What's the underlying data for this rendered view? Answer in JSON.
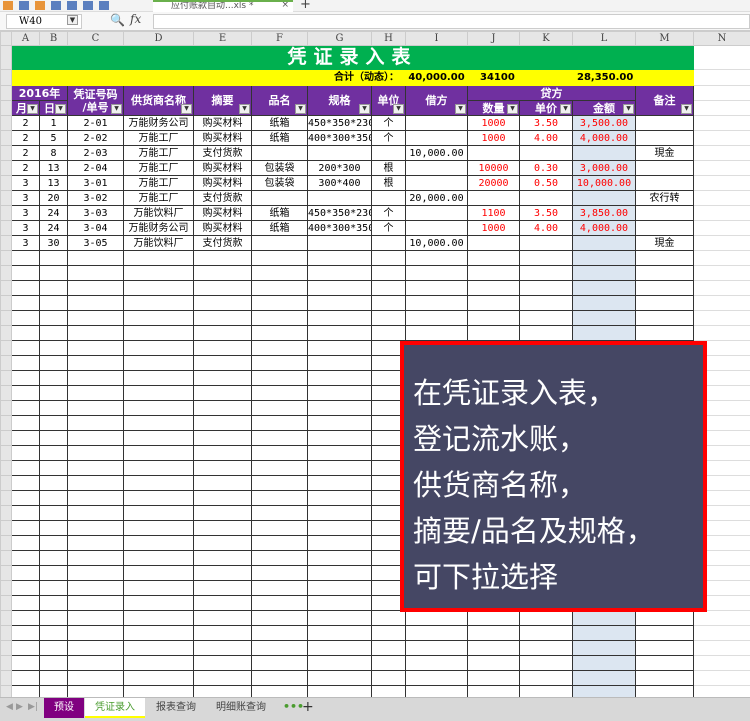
{
  "window": {
    "file_tab": "应付账款自动...xls *",
    "close": "×",
    "new_tab": "+"
  },
  "formula_bar": {
    "cell_ref": "W40",
    "fx": "fx",
    "value": ""
  },
  "columns": [
    "A",
    "B",
    "C",
    "D",
    "E",
    "F",
    "G",
    "H",
    "I",
    "J",
    "K",
    "L",
    "M",
    "N"
  ],
  "sheet": {
    "title": "凭证录入表",
    "total_label": "合计（动态）：",
    "total_debit": "40,000.00",
    "total_qty": "34100",
    "total_amount": "28,350.00",
    "headers": {
      "year": "2016年",
      "month": "月",
      "day": "日",
      "voucher_l1": "凭证号码",
      "voucher_l2": "/单号",
      "supplier": "供货商名称",
      "summary": "摘要",
      "product": "品名",
      "spec": "规格",
      "unit": "单位",
      "debit": "借方",
      "credit": "贷方",
      "qty": "数量",
      "price": "单价",
      "amount": "金额",
      "note": "备注"
    },
    "rows": [
      {
        "month": "2",
        "day": "1",
        "voucher": "2-01",
        "supplier": "万能财务公司",
        "summary": "购买材料",
        "product": "纸箱",
        "spec": "450*350*230",
        "unit": "个",
        "debit": "",
        "qty": "1000",
        "price": "3.50",
        "amount": "3,500.00",
        "note": ""
      },
      {
        "month": "2",
        "day": "5",
        "voucher": "2-02",
        "supplier": "万能工厂",
        "summary": "购买材料",
        "product": "纸箱",
        "spec": "400*300*350",
        "unit": "个",
        "debit": "",
        "qty": "1000",
        "price": "4.00",
        "amount": "4,000.00",
        "note": ""
      },
      {
        "month": "2",
        "day": "8",
        "voucher": "2-03",
        "supplier": "万能工厂",
        "summary": "支付货款",
        "product": "",
        "spec": "",
        "unit": "",
        "debit": "10,000.00",
        "qty": "",
        "price": "",
        "amount": "",
        "note": "現金"
      },
      {
        "month": "2",
        "day": "13",
        "voucher": "2-04",
        "supplier": "万能工厂",
        "summary": "购买材料",
        "product": "包装袋",
        "spec": "200*300",
        "unit": "根",
        "debit": "",
        "qty": "10000",
        "price": "0.30",
        "amount": "3,000.00",
        "note": ""
      },
      {
        "month": "3",
        "day": "13",
        "voucher": "3-01",
        "supplier": "万能工厂",
        "summary": "购买材料",
        "product": "包装袋",
        "spec": "300*400",
        "unit": "根",
        "debit": "",
        "qty": "20000",
        "price": "0.50",
        "amount": "10,000.00",
        "note": ""
      },
      {
        "month": "3",
        "day": "20",
        "voucher": "3-02",
        "supplier": "万能工厂",
        "summary": "支付货款",
        "product": "",
        "spec": "",
        "unit": "",
        "debit": "20,000.00",
        "qty": "",
        "price": "",
        "amount": "",
        "note": "农行转"
      },
      {
        "month": "3",
        "day": "24",
        "voucher": "3-03",
        "supplier": "万能饮料厂",
        "summary": "购买材料",
        "product": "纸箱",
        "spec": "450*350*230",
        "unit": "个",
        "debit": "",
        "qty": "1100",
        "price": "3.50",
        "amount": "3,850.00",
        "note": ""
      },
      {
        "month": "3",
        "day": "24",
        "voucher": "3-04",
        "supplier": "万能财务公司",
        "summary": "购买材料",
        "product": "纸箱",
        "spec": "400*300*350",
        "unit": "个",
        "debit": "",
        "qty": "1000",
        "price": "4.00",
        "amount": "4,000.00",
        "note": ""
      },
      {
        "month": "3",
        "day": "30",
        "voucher": "3-05",
        "supplier": "万能饮料厂",
        "summary": "支付货款",
        "product": "",
        "spec": "",
        "unit": "",
        "debit": "10,000.00",
        "qty": "",
        "price": "",
        "amount": "",
        "note": "現金"
      }
    ],
    "empty_rows": 30
  },
  "sheet_tabs": [
    {
      "label": "预设"
    },
    {
      "label": "凭证录入"
    },
    {
      "label": "报表查询"
    },
    {
      "label": "明细账查询"
    }
  ],
  "tab_more": "•••",
  "tab_add": "+",
  "callout": {
    "lines": [
      "在凭证录入表，",
      "登记流水账，",
      "供货商名称，",
      "摘要/品名及规格，",
      "可下拉选择"
    ]
  },
  "colors": {
    "title_bg": "#00b050",
    "total_bg": "#ffff00",
    "header_bg": "#7030a0",
    "credit_text": "#ff0000",
    "amount_col_bg": "#dce6f1",
    "callout_bg": "#454764",
    "callout_border": "#ff0000"
  }
}
